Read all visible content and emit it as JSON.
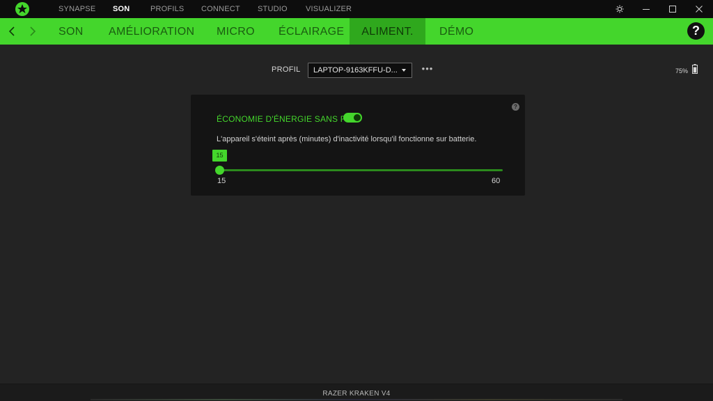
{
  "app": {
    "top_tabs": [
      {
        "label": "SYNAPSE",
        "active": false
      },
      {
        "label": "SON",
        "active": true
      },
      {
        "label": "PROFILS",
        "active": false
      },
      {
        "label": "CONNECT",
        "active": false
      },
      {
        "label": "STUDIO",
        "active": false
      },
      {
        "label": "VISUALIZER",
        "active": false
      }
    ],
    "window_controls": [
      "settings-icon",
      "minimize-icon",
      "maximize-icon",
      "close-icon"
    ]
  },
  "subnav": {
    "tabs": [
      {
        "label": "SON",
        "active": false
      },
      {
        "label": "AMÉLIORATION",
        "active": false
      },
      {
        "label": "MICRO",
        "active": false
      },
      {
        "label": "ÉCLAIRAGE",
        "active": false
      },
      {
        "label": "ALIMENT.",
        "active": true
      },
      {
        "label": "DÉMO",
        "active": false
      }
    ],
    "help_label": "?"
  },
  "profile": {
    "label": "PROFIL",
    "selected": "LAPTOP-9163KFFU-D...",
    "more_label": "•••"
  },
  "battery": {
    "level_text": "75%",
    "level": 0.75
  },
  "power_card": {
    "title": "ÉCONOMIE D'ÉNERGIE SANS FIL",
    "toggle_on": true,
    "description": "L'appareil s'éteint après (minutes) d'inactivité lorsqu'il fonctionne sur batterie.",
    "help_label": "?",
    "slider": {
      "value": 15,
      "value_text": "15",
      "min": 15,
      "min_text": "15",
      "max": 60,
      "max_text": "60"
    }
  },
  "footer": {
    "device_name": "RAZER KRAKEN V4"
  },
  "colors": {
    "accent": "#44d62c",
    "accent_dark": "#2fa81d",
    "background": "#232323",
    "card": "#141414"
  }
}
